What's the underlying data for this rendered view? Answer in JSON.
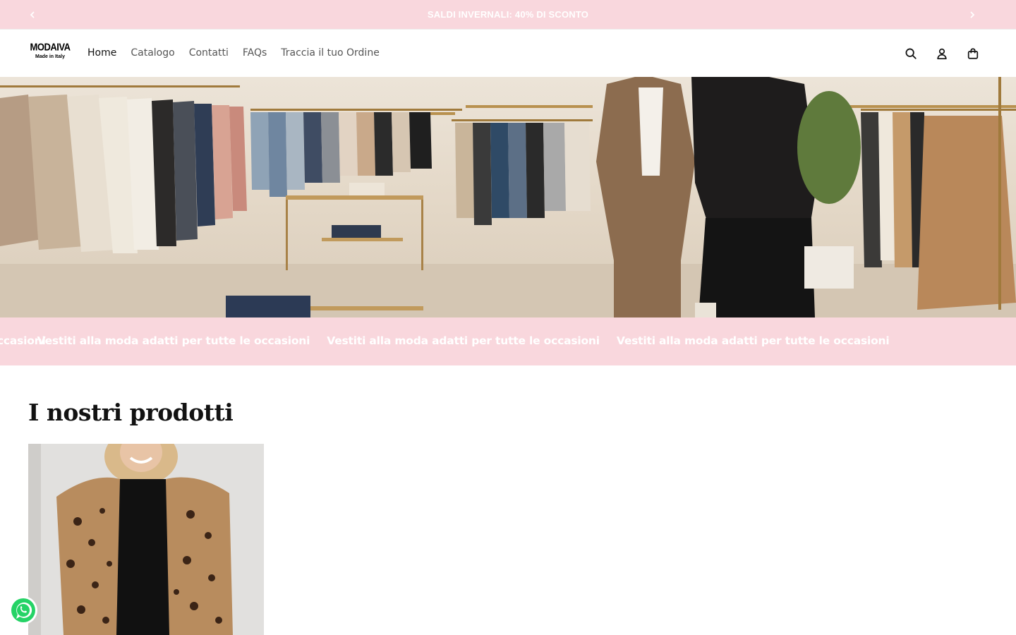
{
  "announcement": {
    "text": "SALDI INVERNALI: 40% DI SCONTO",
    "text_color": "#ffffff",
    "background": "#f9d7dd"
  },
  "header": {
    "logo": {
      "name": "MODAIVA",
      "tagline": "Made in Italy"
    },
    "nav": [
      {
        "label": "Home",
        "active": true
      },
      {
        "label": "Catalogo",
        "active": false
      },
      {
        "label": "Contatti",
        "active": false
      },
      {
        "label": "FAQs",
        "active": false
      },
      {
        "label": "Traccia il tuo Ordine",
        "active": false
      }
    ],
    "icons": [
      "search-icon",
      "account-icon",
      "cart-icon"
    ]
  },
  "hero": {
    "image_alt": "clothing store interior with racks of coats and mannequins"
  },
  "marquee": {
    "items": [
      "Vestiti alla moda adatti per tutte le occasioni",
      "Vestiti alla moda adatti per tutte le occasioni",
      "Vestiti alla moda adatti per tutte le occasioni",
      "Vestiti alla moda adatti per tutte le occasioni"
    ]
  },
  "products": {
    "title": "I nostri prodotti",
    "items": [
      {
        "image_alt": "leopard print faux fur coat"
      }
    ]
  },
  "floating": {
    "whatsapp_icon": "whatsapp-icon",
    "whatsapp_color": "#25d366"
  }
}
